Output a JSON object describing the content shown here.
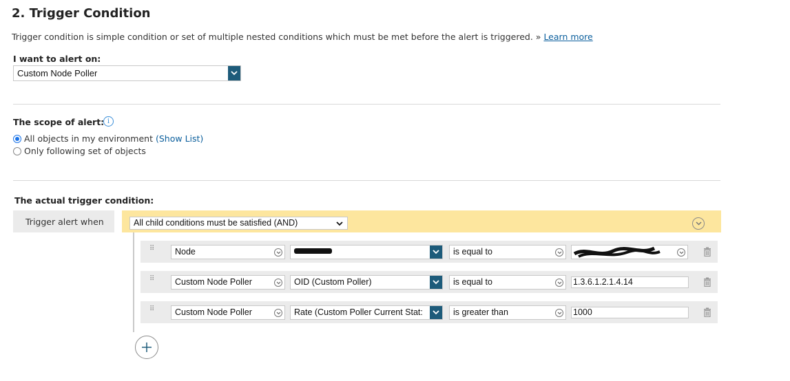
{
  "section": {
    "title": "2. Trigger Condition",
    "description": "Trigger condition is simple condition or set of multiple nested conditions which must be met before the alert is triggered. »",
    "learn_more": "Learn more"
  },
  "alert_on": {
    "label": "I want to alert on:",
    "value": "Custom Node Poller"
  },
  "scope": {
    "label": "The scope of alert:",
    "option_all": "All objects in my environment",
    "show_list": "(Show List)",
    "option_following": "Only following set of objects",
    "selected": "all"
  },
  "trigger": {
    "label": "The actual trigger condition:",
    "when_label": "Trigger alert when",
    "logic_value": "All child conditions must be satisfied (AND)",
    "rows": [
      {
        "field": "Node",
        "property": "",
        "operator": "is equal to",
        "value": ""
      },
      {
        "field": "Custom Node Poller",
        "property": "OID (Custom Poller)",
        "operator": "is equal to",
        "value": "1.3.6.1.2.1.4.14"
      },
      {
        "field": "Custom Node Poller",
        "property": "Rate (Custom Poller Current Stat:",
        "operator": "is greater than",
        "value": "1000"
      }
    ]
  },
  "colors": {
    "accent_blue": "#1d5b7a",
    "condition_bar": "#fde69e",
    "row_bg": "#ebebeb",
    "link": "#0a5e9c"
  },
  "icons": {
    "info": "info-icon",
    "add": "plus-circle-icon",
    "delete": "trash-icon",
    "drag": "drag-handle-icon",
    "collapse": "chevron-down-circle-icon"
  }
}
